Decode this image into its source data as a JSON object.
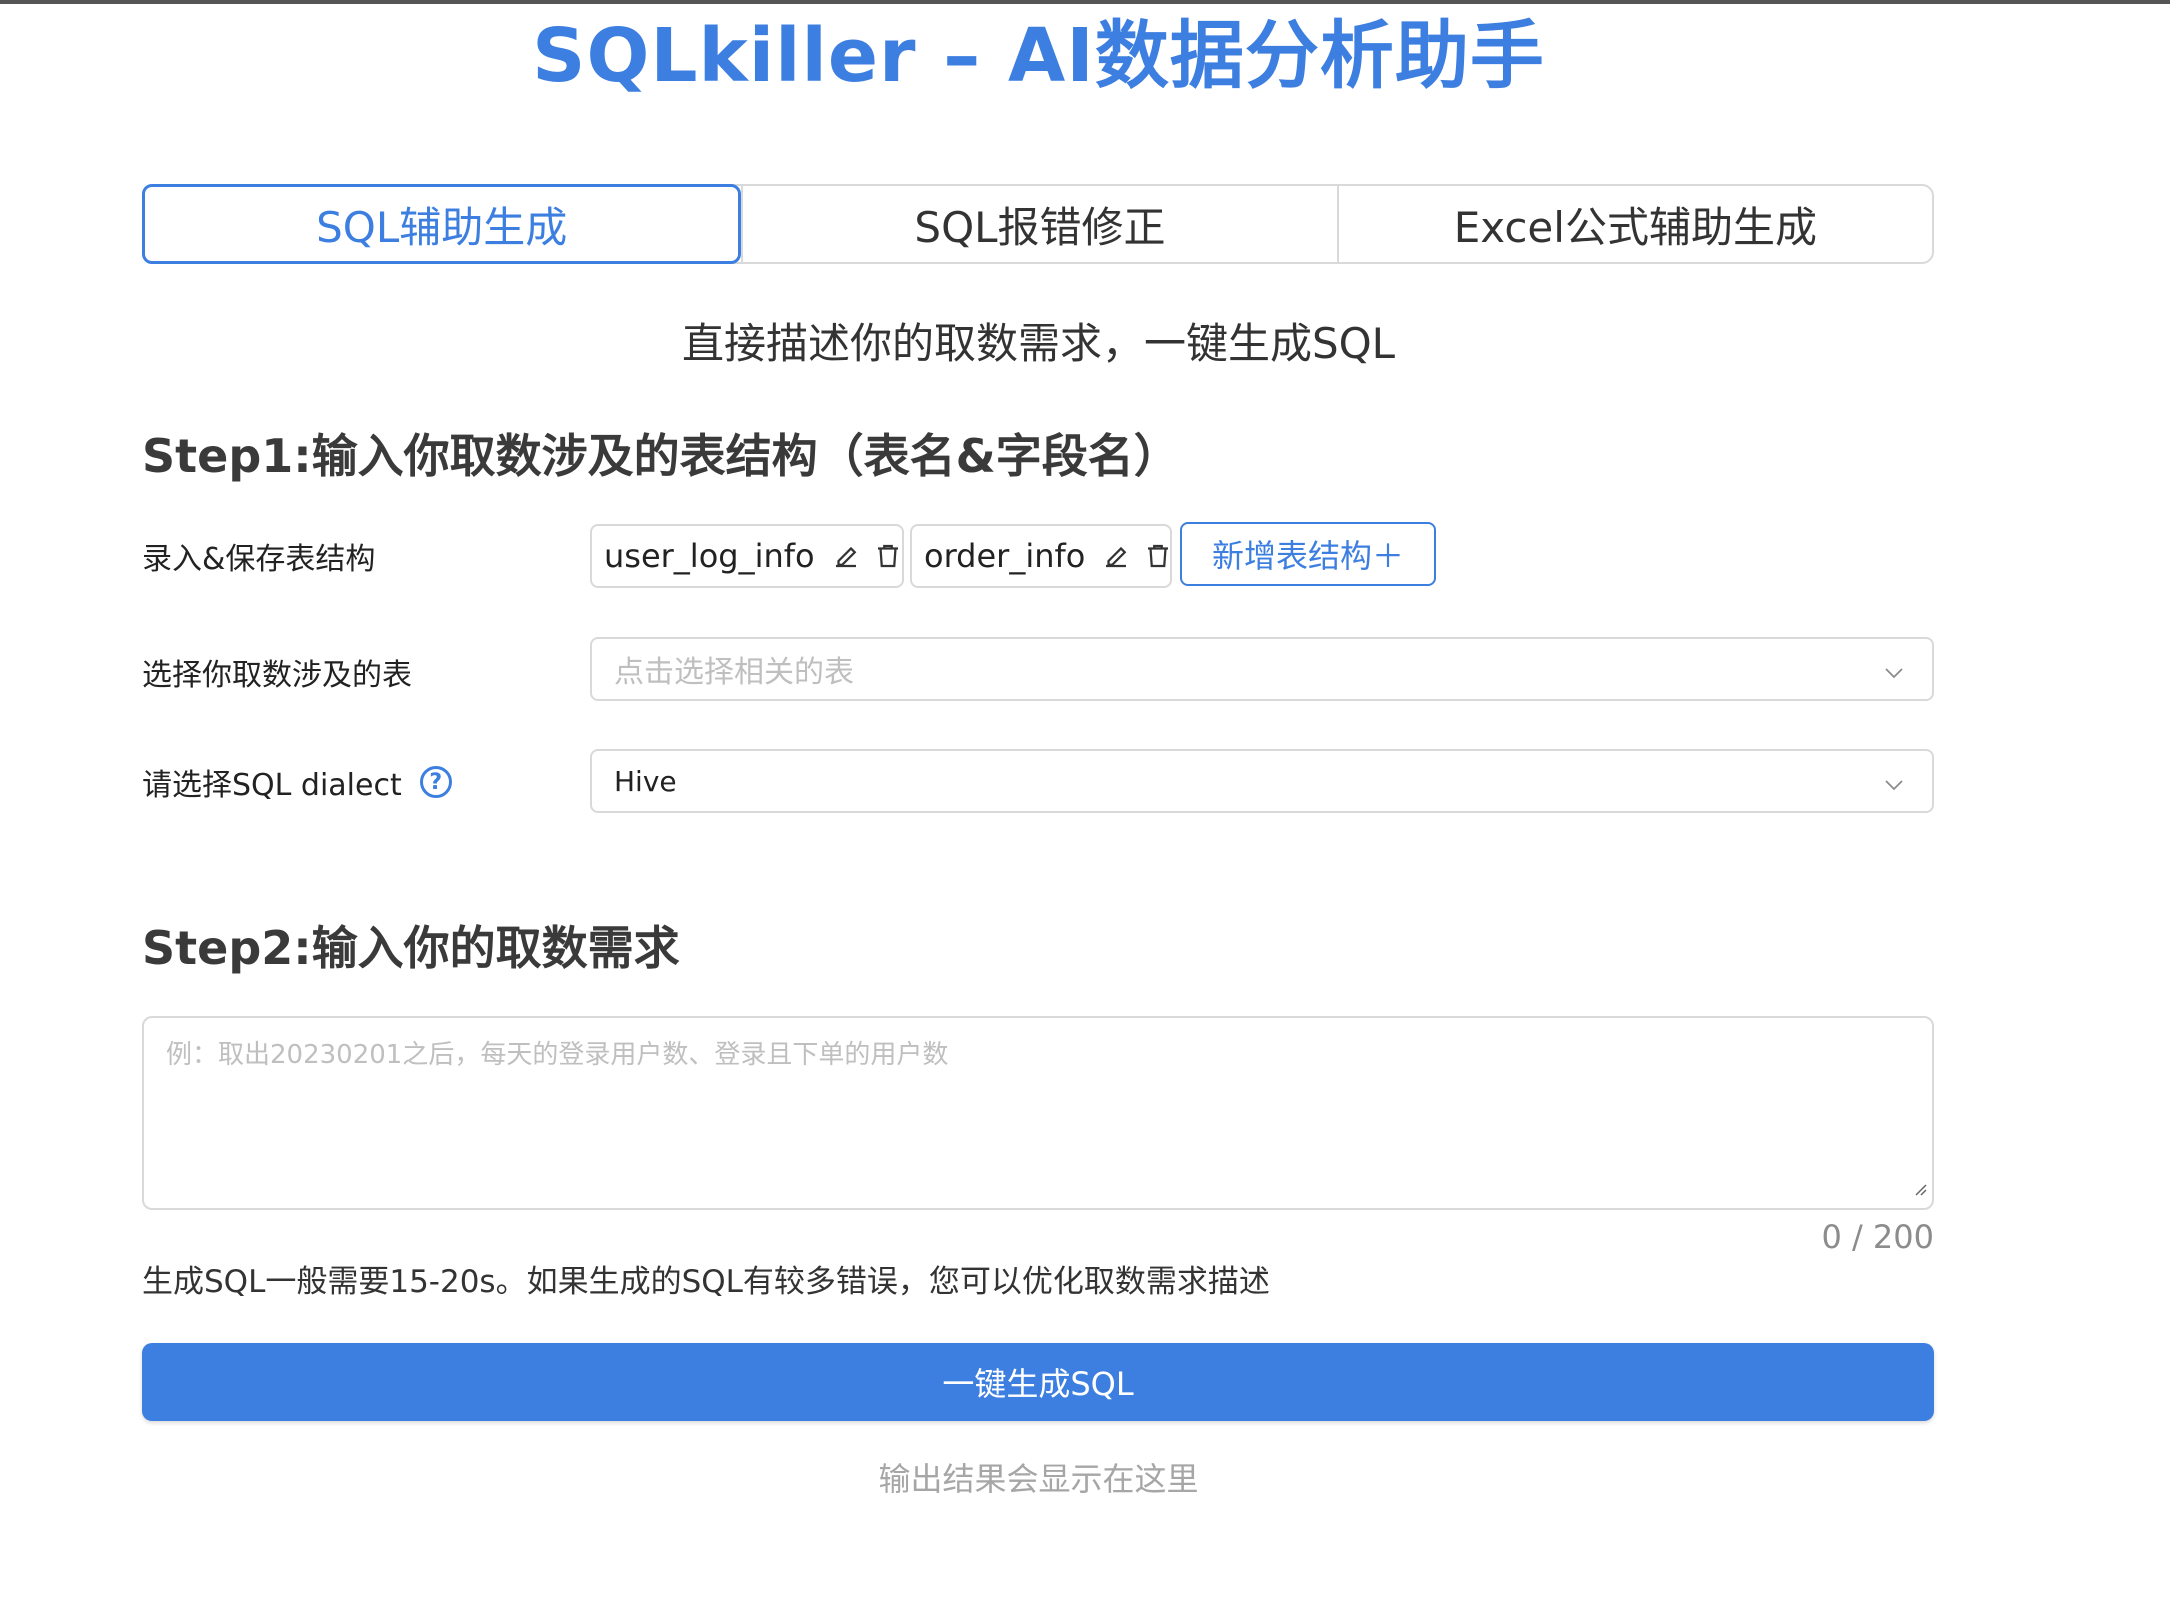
{
  "app": {
    "title": "SQLkiller – AI数据分析助手"
  },
  "tabs": [
    {
      "label": "SQL辅助生成",
      "active": true
    },
    {
      "label": "SQL报错修正",
      "active": false
    },
    {
      "label": "Excel公式辅助生成",
      "active": false
    }
  ],
  "subtitle": "直接描述你的取数需求，一键生成SQL",
  "step1": {
    "title": "Step1:输入你取数涉及的表结构（表名&字段名）",
    "tables_label": "录入&保存表结构",
    "tables": [
      {
        "name": "user_log_info"
      },
      {
        "name": "order_info"
      }
    ],
    "add_table_label": "新增表结构＋",
    "select_tables_label": "选择你取数涉及的表",
    "select_tables_placeholder": "点击选择相关的表",
    "dialect_label": "请选择SQL dialect",
    "dialect_value": "Hive"
  },
  "step2": {
    "title": "Step2:输入你的取数需求",
    "placeholder": "例：取出20230201之后，每天的登录用户数、登录且下单的用户数",
    "counter": "0 / 200",
    "hint": "生成SQL一般需要15-20s。如果生成的SQL有较多错误，您可以优化取数需求描述",
    "generate_label": "一键生成SQL",
    "output_placeholder": "输出结果会显示在这里"
  },
  "colors": {
    "accent": "#3d7fe0",
    "border": "#d9d9d9",
    "placeholder": "#bfbfbf"
  },
  "icons": {
    "edit": "pencil-icon",
    "delete": "trash-icon",
    "help": "question-circle-icon",
    "dropdown": "chevron-down-icon"
  }
}
